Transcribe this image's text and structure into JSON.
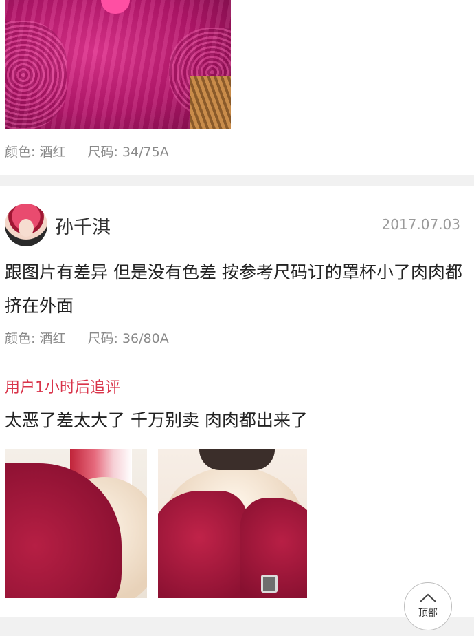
{
  "first_review": {
    "spec": {
      "color_label": "颜色:",
      "color_value": "酒红",
      "size_label": "尺码:",
      "size_value": "34/75A"
    }
  },
  "second_review": {
    "username": "孙千淇",
    "date": "2017.07.03",
    "text": "跟图片有差异 但是没有色差 按参考尺码订的罩杯小了肉肉都挤在外面",
    "spec": {
      "color_label": "颜色:",
      "color_value": "酒红",
      "size_label": "尺码:",
      "size_value": "36/80A"
    },
    "followup": {
      "title": "用户1小时后追评",
      "text": "太恶了差太大了 千万别卖 肉肉都出来了"
    }
  },
  "back_to_top": {
    "label": "顶部",
    "icon": "chevron-up-icon"
  },
  "colors": {
    "accent_red": "#d9344a",
    "muted_text": "#8a8a8a",
    "section_gap": "#f1f1f1"
  }
}
